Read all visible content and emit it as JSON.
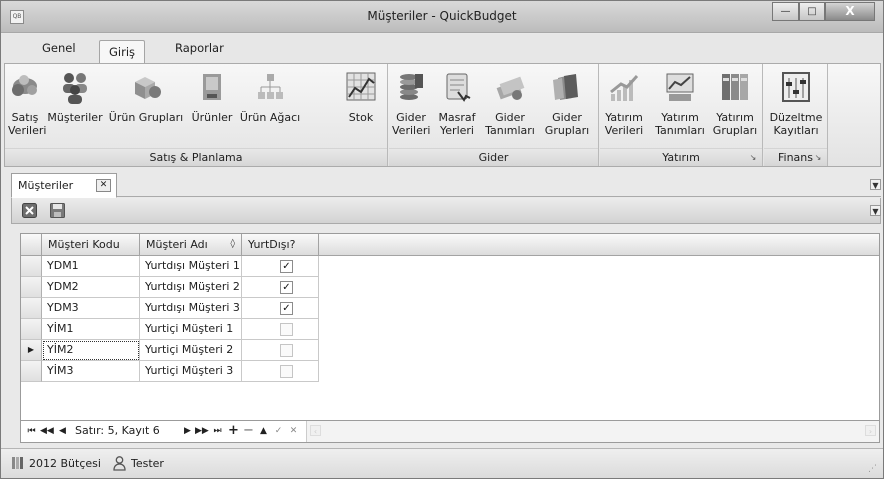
{
  "window": {
    "title": "Müşteriler - QuickBudget",
    "app_icon": "QB",
    "controls": {
      "minimize": "—",
      "maximize": "□",
      "close": "X"
    }
  },
  "menu": {
    "tabs": [
      {
        "label": "Genel",
        "active": false
      },
      {
        "label": "Giriş",
        "active": true
      },
      {
        "label": "Raporlar",
        "active": false
      }
    ]
  },
  "ribbon": {
    "groups": [
      {
        "caption": "Satış & Planlama",
        "buttons": [
          {
            "label1": "Satış",
            "label2": "Verileri",
            "icon": "sales-data-icon"
          },
          {
            "label1": "Müşteriler",
            "label2": "",
            "icon": "customers-icon"
          },
          {
            "label1": "Ürün Grupları",
            "label2": "",
            "icon": "product-groups-icon"
          },
          {
            "label1": "Ürünler",
            "label2": "",
            "icon": "products-icon"
          },
          {
            "label1": "Ürün Ağacı",
            "label2": "",
            "icon": "product-tree-icon"
          },
          {
            "label1": "Stok",
            "label2": "",
            "icon": "stock-icon"
          }
        ]
      },
      {
        "caption": "Gider",
        "buttons": [
          {
            "label1": "Gider",
            "label2": "Verileri",
            "icon": "expense-data-icon"
          },
          {
            "label1": "Masraf",
            "label2": "Yerleri",
            "icon": "cost-centers-icon"
          },
          {
            "label1": "Gider",
            "label2": "Tanımları",
            "icon": "expense-definitions-icon"
          },
          {
            "label1": "Gider",
            "label2": "Grupları",
            "icon": "expense-groups-icon"
          }
        ]
      },
      {
        "caption": "Yatırım",
        "buttons": [
          {
            "label1": "Yatırım",
            "label2": "Verileri",
            "icon": "investment-data-icon"
          },
          {
            "label1": "Yatırım",
            "label2": "Tanımları",
            "icon": "investment-definitions-icon"
          },
          {
            "label1": "Yatırım",
            "label2": "Grupları",
            "icon": "investment-groups-icon"
          }
        ]
      },
      {
        "caption": "Finans",
        "buttons": [
          {
            "label1": "Düzeltme",
            "label2": "Kayıtları",
            "icon": "adjustment-records-icon"
          }
        ]
      }
    ]
  },
  "document_tab": {
    "label": "Müşteriler",
    "close": "✕"
  },
  "grid": {
    "columns": [
      "Müşteri Kodu",
      "Müşteri Adı",
      "YurtDışı?"
    ],
    "sort_glyph": "◊",
    "current_row_glyph": "▶",
    "rows": [
      {
        "code": "YDM1",
        "name": "Yurtdışı Müşteri 1",
        "abroad": true,
        "current": false
      },
      {
        "code": "YDM2",
        "name": "Yurtdışı Müşteri 2",
        "abroad": true,
        "current": false
      },
      {
        "code": "YDM3",
        "name": "Yurtdışı Müşteri 3",
        "abroad": true,
        "current": false
      },
      {
        "code": "YİM1",
        "name": "Yurtiçi Müşteri 1",
        "abroad": false,
        "current": false
      },
      {
        "code": "YİM2",
        "name": "Yurtiçi Müşteri 2",
        "abroad": false,
        "current": true
      },
      {
        "code": "YİM3",
        "name": "Yurtiçi Müşteri 3",
        "abroad": false,
        "current": false
      }
    ]
  },
  "navigator": {
    "status": "Satır: 5, Kayıt 6",
    "buttons_left": [
      "⏮",
      "◀◀",
      "◀"
    ],
    "buttons_right": [
      "▶",
      "▶▶",
      "⏭",
      "+",
      "−",
      "▲",
      "✓",
      "✕"
    ]
  },
  "statusbar": {
    "budget": "2012 Bütçesi",
    "user": "Tester"
  }
}
